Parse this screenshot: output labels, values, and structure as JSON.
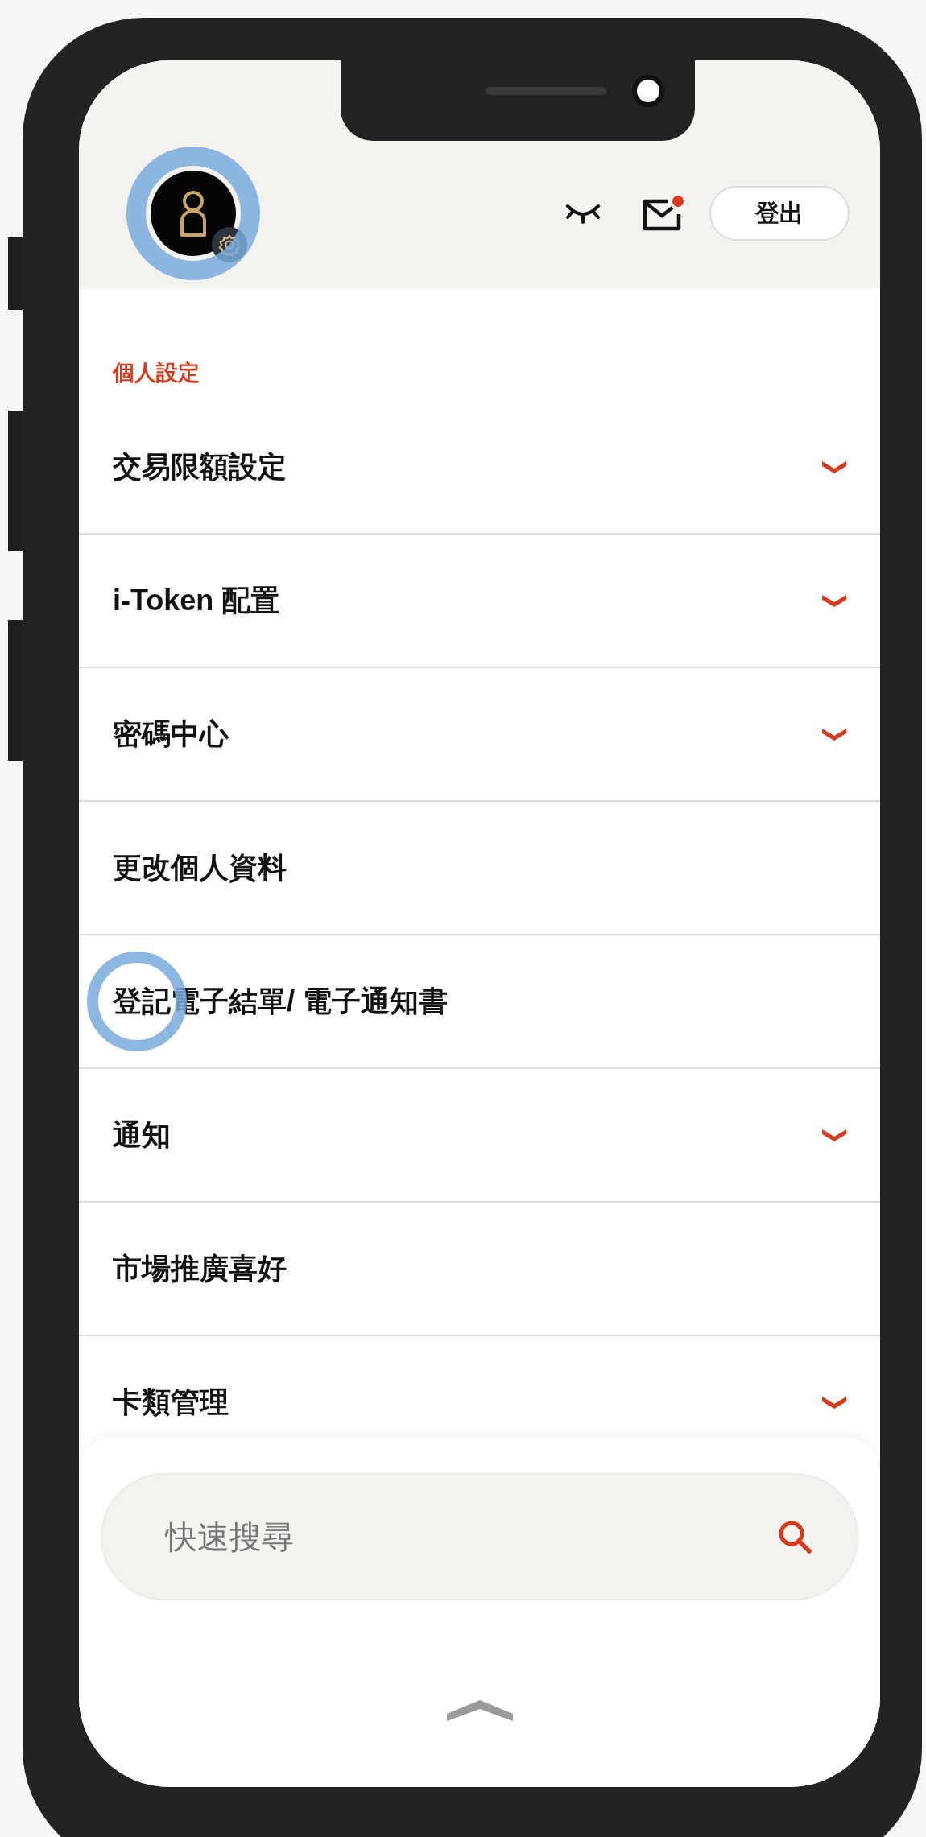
{
  "header": {
    "logout_button": "登出",
    "mail_unread": true
  },
  "section_title": "個人設定",
  "menu_items": [
    {
      "label": "交易限額設定",
      "expandable": true
    },
    {
      "label": "i-Token 配置",
      "expandable": true
    },
    {
      "label": "密碼中心",
      "expandable": true
    },
    {
      "label": "更改個人資料",
      "expandable": false
    },
    {
      "label": "登記電子結單/ 電子通知書",
      "expandable": false
    },
    {
      "label": "通知",
      "expandable": true
    },
    {
      "label": "市場推廣喜好",
      "expandable": false
    },
    {
      "label": "卡類管理",
      "expandable": true
    }
  ],
  "search": {
    "placeholder": "快速搜尋"
  }
}
